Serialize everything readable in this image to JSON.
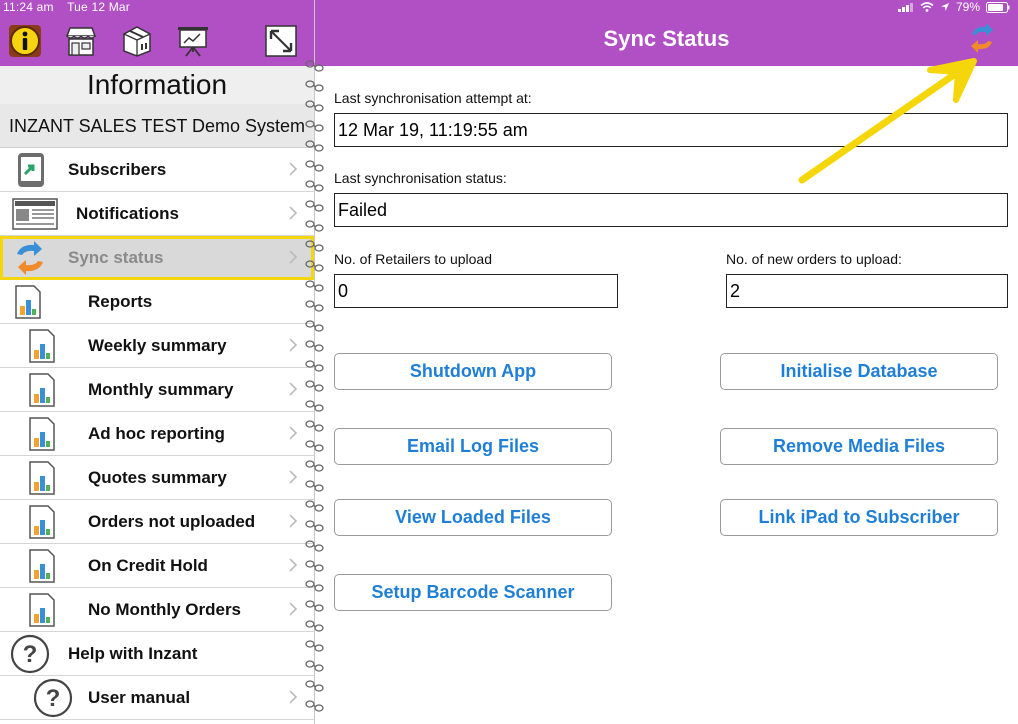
{
  "status_bar": {
    "time": "11:24 am",
    "date": "Tue 12 Mar",
    "battery": "79%"
  },
  "toolbar": {
    "icons": [
      "info-icon",
      "store-icon",
      "package-icon",
      "presentation-icon",
      "expand-icon"
    ]
  },
  "sidebar": {
    "title": "Information",
    "system_name": "INZANT SALES TEST Demo System",
    "items": [
      {
        "label": "Subscribers",
        "icon": "tablet-icon"
      },
      {
        "label": "Notifications",
        "icon": "newspaper-icon"
      },
      {
        "label": "Sync status",
        "icon": "sync-icon"
      },
      {
        "label": "Reports",
        "icon": "report-icon"
      },
      {
        "label": "Weekly summary",
        "icon": "report-icon"
      },
      {
        "label": "Monthly summary",
        "icon": "report-icon"
      },
      {
        "label": "Ad hoc reporting",
        "icon": "report-icon"
      },
      {
        "label": "Quotes summary",
        "icon": "report-icon"
      },
      {
        "label": "Orders not uploaded",
        "icon": "report-icon"
      },
      {
        "label": "On Credit Hold",
        "icon": "report-icon"
      },
      {
        "label": "No Monthly Orders",
        "icon": "report-icon"
      },
      {
        "label": "Help with Inzant",
        "icon": "help-icon"
      },
      {
        "label": "User manual",
        "icon": "help-icon"
      }
    ]
  },
  "header": {
    "title": "Sync Status"
  },
  "sync": {
    "last_attempt_label": "Last synchronisation attempt at:",
    "last_attempt_value": "12 Mar 19, 11:19:55 am",
    "last_status_label": "Last synchronisation status:",
    "last_status_value": "Failed",
    "retailers_label": "No. of Retailers to upload",
    "retailers_value": "0",
    "orders_label": "No. of new orders to upload:",
    "orders_value": "2"
  },
  "actions": {
    "shutdown": "Shutdown App",
    "init_db": "Initialise Database",
    "email_logs": "Email Log Files",
    "remove_media": "Remove Media Files",
    "view_files": "View Loaded Files",
    "link_ipad": "Link iPad to Subscriber",
    "barcode": "Setup Barcode Scanner"
  },
  "colors": {
    "header_purple": "#b14fc5",
    "button_text_blue": "#1f7fd6",
    "highlight_yellow": "#f3d60d"
  }
}
